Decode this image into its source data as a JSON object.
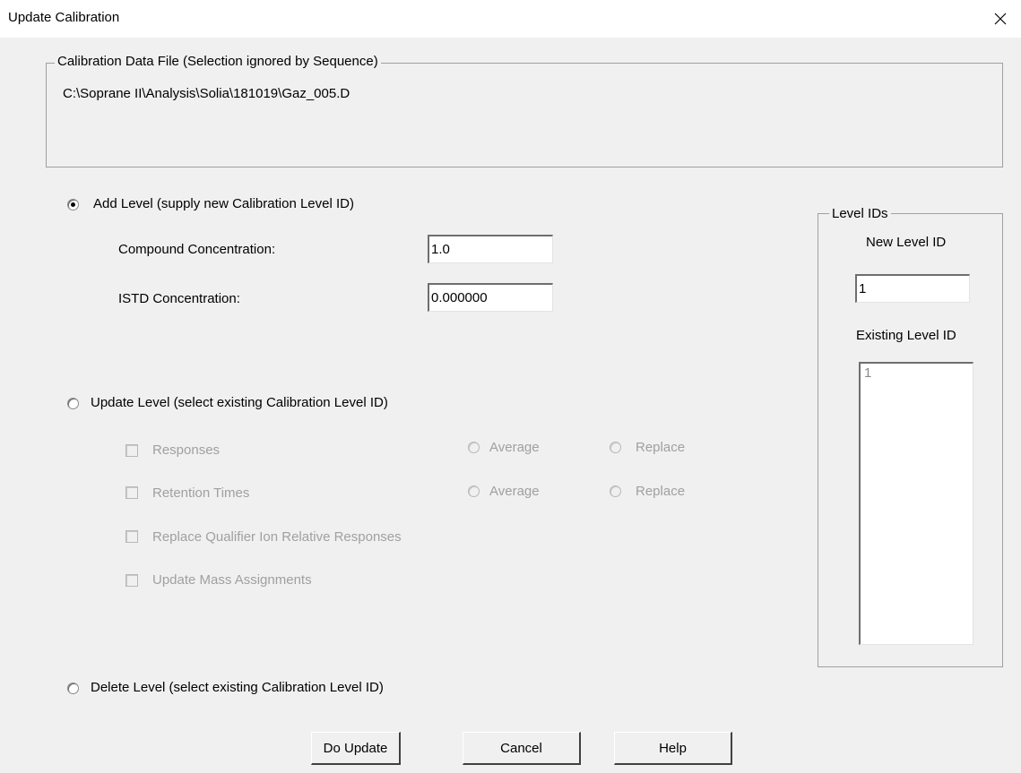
{
  "window": {
    "title": "Update Calibration",
    "close_glyph": "✕"
  },
  "data_file": {
    "legend": "Calibration Data File (Selection ignored by Sequence)",
    "path": "C:\\Soprane II\\Analysis\\Solia\\181019\\Gaz_005.D"
  },
  "add_level": {
    "label": "Add Level (supply new Calibration Level ID)",
    "selected": true,
    "compound_label": "Compound Concentration:",
    "compound_value": "1.0",
    "istd_label": "ISTD Concentration:",
    "istd_value": "0.000000"
  },
  "update_level": {
    "label": "Update Level (select existing Calibration Level ID)",
    "selected": false,
    "responses_label": "Responses",
    "retention_label": "Retention Times",
    "average_label": "Average",
    "replace_label": "Replace",
    "qualifier_label": "Replace Qualifier Ion Relative Responses",
    "mass_label": "Update Mass Assignments"
  },
  "delete_level": {
    "label": "Delete Level (select existing Calibration Level ID)",
    "selected": false
  },
  "level_ids": {
    "legend": "Level IDs",
    "new_label": "New Level ID",
    "new_value": "1",
    "existing_label": "Existing Level ID",
    "existing_items": [
      "1"
    ]
  },
  "buttons": {
    "do_update": "Do Update",
    "cancel": "Cancel",
    "help": "Help"
  }
}
